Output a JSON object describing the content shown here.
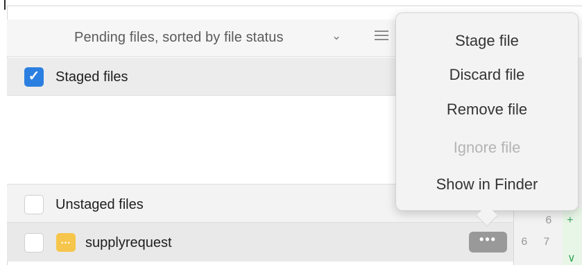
{
  "toolbar": {
    "title": "Pending files, sorted by file status",
    "sort_chevron": "⌄",
    "view_icon": "list-icon"
  },
  "staged": {
    "checked": true,
    "label": "Staged files"
  },
  "unstaged": {
    "checked": false,
    "label": "Unstaged files"
  },
  "files": [
    {
      "name": "supplyrequest",
      "checked": false,
      "status_icon": "…",
      "status_color": "#f6c54b",
      "more_label": "•••"
    }
  ],
  "diff_gutter": {
    "lines": [
      {
        "old": "",
        "new": "6",
        "marker": "+"
      },
      {
        "old": "6",
        "new": "7",
        "marker": ""
      }
    ]
  },
  "context_menu": {
    "items": [
      {
        "label": "Stage file",
        "enabled": true
      },
      {
        "label": "Discard file",
        "enabled": true
      },
      {
        "label": "Remove file",
        "enabled": true
      },
      {
        "label": "Ignore file",
        "enabled": false
      },
      {
        "label": "Show in Finder",
        "enabled": true
      }
    ]
  },
  "colors": {
    "accent": "#2b7fe0",
    "modified": "#f6c54b",
    "added": "#3aa55c"
  }
}
